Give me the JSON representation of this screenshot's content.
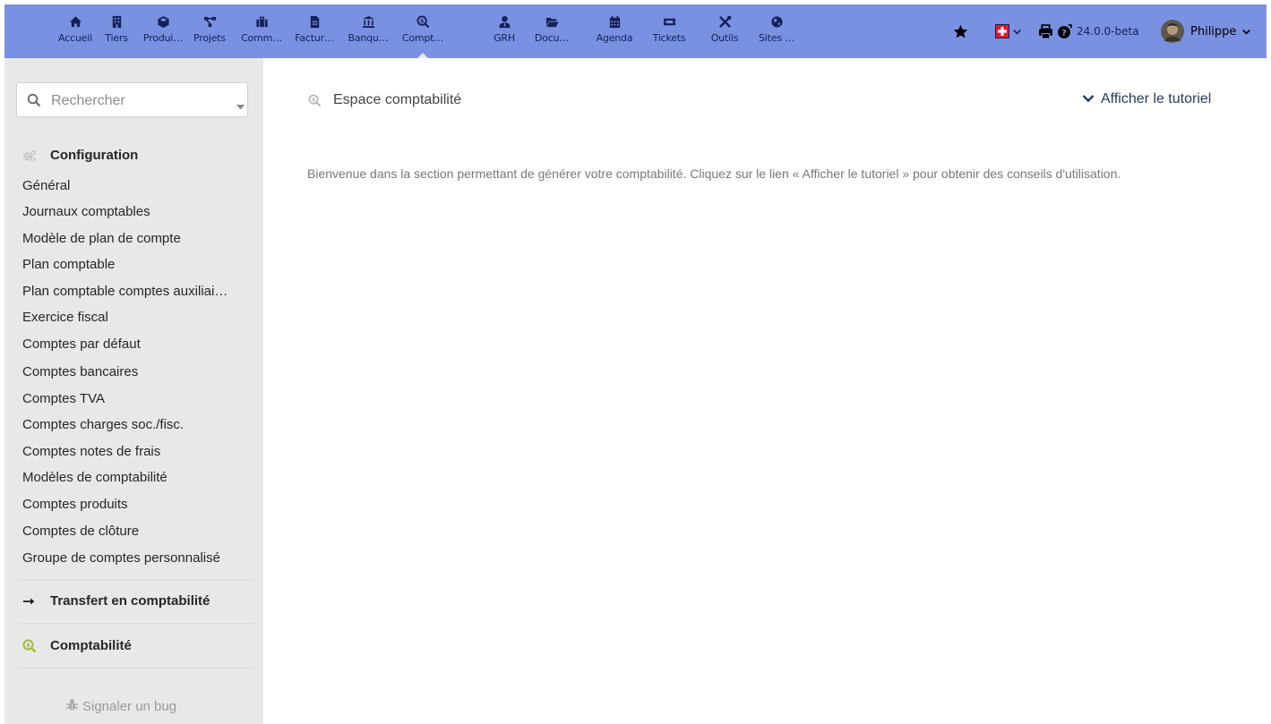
{
  "topbar": {
    "nav": [
      {
        "label": "Accueil",
        "icon": "home-icon"
      },
      {
        "label": "Tiers",
        "icon": "building-icon"
      },
      {
        "label": "Produi…",
        "icon": "cube-icon"
      },
      {
        "label": "Projets",
        "icon": "project-diagram-icon"
      },
      {
        "label": "Comm…",
        "icon": "briefcase-icon"
      },
      {
        "label": "Factur…",
        "icon": "invoice-icon"
      },
      {
        "label": "Banqu…",
        "icon": "university-icon"
      },
      {
        "label": "Compt…",
        "icon": "search-dollar-icon",
        "active": true
      },
      {
        "label": "GRH",
        "icon": "user-tie-icon"
      },
      {
        "label": "Docu…",
        "icon": "folder-open-icon"
      },
      {
        "label": "Agenda",
        "icon": "calendar-icon"
      },
      {
        "label": "Tickets",
        "icon": "ticket-icon"
      },
      {
        "label": "Outils",
        "icon": "tools-icon"
      },
      {
        "label": "Sites …",
        "icon": "globe-icon"
      }
    ],
    "version": "24.0.0-beta",
    "user": {
      "name": "Philippe"
    },
    "right_icons": [
      "star-icon",
      "language-flag-icon",
      "print-icon",
      "help-icon"
    ]
  },
  "sidebar": {
    "search": {
      "placeholder": "Rechercher"
    },
    "configuration": {
      "title": "Configuration",
      "items": [
        "Général",
        "Journaux comptables",
        "Modèle de plan de compte",
        "Plan comptable",
        "Plan comptable comptes auxiliai…",
        "Exercice fiscal",
        "Comptes par défaut",
        "Comptes bancaires",
        "Comptes TVA",
        "Comptes charges soc./fisc.",
        "Comptes notes de frais",
        "Modèles de comptabilité",
        "Comptes produits",
        "Comptes de clôture",
        "Groupe de comptes personnalisé"
      ]
    },
    "transfer": {
      "title": "Transfert en comptabilité"
    },
    "accounting": {
      "title": "Comptabilité"
    },
    "bug_link": "Signaler un bug"
  },
  "main": {
    "title": "Espace comptabilité",
    "tutorial_link": "Afficher le tutoriel",
    "welcome": "Bienvenue dans la section permettant de générer votre comptabilité. Cliquez sur le lien « Afficher le tutoriel » pour obtenir des conseils d'utilisation."
  },
  "colors": {
    "topbar": "#7a91e2",
    "sidebar": "#e8e8e8",
    "icon_dark": "#15205a",
    "accent_green": "#9dba3a",
    "flag_red": "#e0192d"
  }
}
